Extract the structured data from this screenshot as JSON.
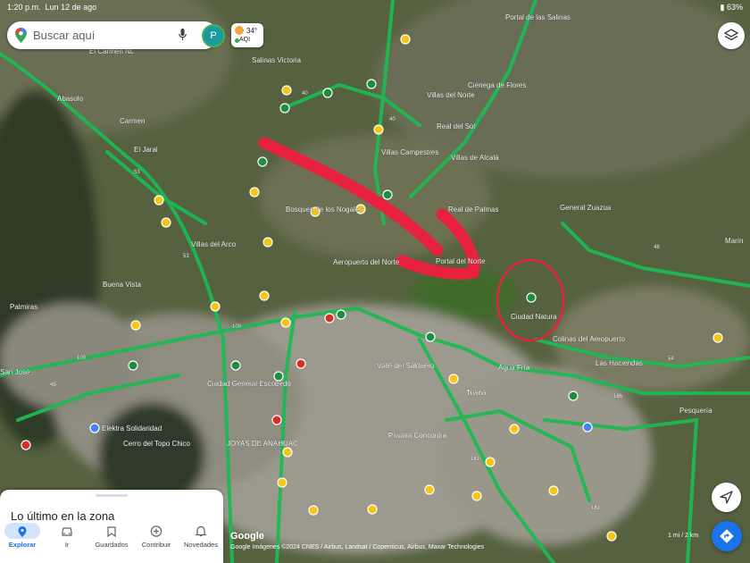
{
  "status": {
    "time": "1:20 p.m.",
    "date": "Lun 12 de ago",
    "battery": "63%"
  },
  "search": {
    "placeholder": "Buscar aquí",
    "avatar_letter": "P"
  },
  "weather": {
    "temp": "34°",
    "aqi": "AQI"
  },
  "bottom_sheet": {
    "title": "Lo último en la zona"
  },
  "nav": [
    {
      "label": "Explorar",
      "icon": "pin-icon",
      "active": true
    },
    {
      "label": "Ir",
      "icon": "car-icon",
      "active": false
    },
    {
      "label": "Guardados",
      "icon": "bookmark-icon",
      "active": false
    },
    {
      "label": "Contribuir",
      "icon": "plus-circle-icon",
      "active": false
    },
    {
      "label": "Novedades",
      "icon": "bell-icon",
      "active": false
    }
  ],
  "map": {
    "places": [
      "Portal de las Salinas",
      "El Carmen NL",
      "Salinas Victoria",
      "Ciénega de Flores",
      "Abasolo",
      "Villas del Norte",
      "Carmen",
      "Real del Sol",
      "El Jaral",
      "Villas Campestres",
      "Villas de Alcalá",
      "Bosques de los Nogales",
      "Real de Palmas",
      "General Zuazua",
      "Villas del Arco",
      "Aeropuerto del Norte",
      "Portal del Norte",
      "Marín",
      "Buena Vista",
      "Ciudad Natura",
      "Palmiras",
      "Colinas del Aeropuerto",
      "Las Haciendas",
      "Agua Fría",
      "Valle del Salduero",
      "Ciudad General Escobedo",
      "Triana",
      "Pesquería",
      "San José",
      "Elektra Solidaridad",
      "Privalia Concordia",
      "Cerro del Topo Chico",
      "JOYAS DE ANÁHUAC"
    ],
    "road_numbers": [
      "40",
      "40",
      "53",
      "53",
      "100",
      "100",
      "45",
      "54",
      "48",
      "186",
      "181",
      "181"
    ],
    "google": "Google",
    "attribution": "Google  Imágenes ©2024 CNES / Airbus, Landsat / Copernicus, Airbus, Maxar Technologies",
    "scale": "1 mi / 2 km"
  },
  "colors": {
    "road": "#1db954",
    "annotation": "#e8213f",
    "accent": "#1a73e8",
    "terrain": "#4a5a3e"
  }
}
